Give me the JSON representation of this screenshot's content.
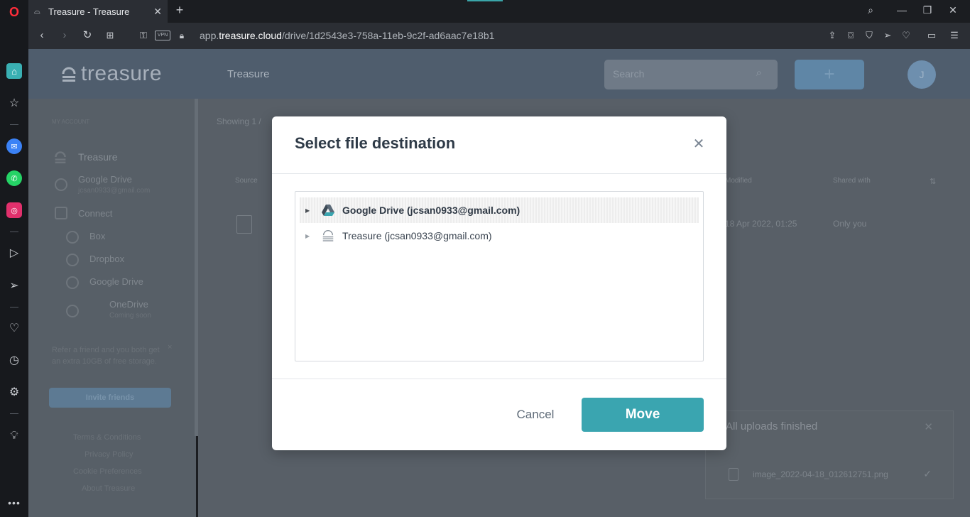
{
  "browser": {
    "tab_title": "Treasure - Treasure",
    "new_tab": "+",
    "url_prefix": "app.",
    "url_domain": "treasure.cloud",
    "url_path": "/drive/1d2543e3-758a-11eb-9c2f-ad6aac7e18b1",
    "vpn_label": "VPN"
  },
  "app": {
    "logo_text": "treasure",
    "header_title": "Treasure",
    "search_placeholder": "Search",
    "add_label": "+",
    "avatar_initial": "J"
  },
  "sidebar": {
    "section_label": "MY ACCOUNT",
    "treasure_label": "Treasure",
    "google_drive_label": "Google Drive",
    "google_drive_email": "jcsan0933@gmail.com",
    "connect_label": "Connect",
    "connect_items": [
      "Box",
      "Dropbox",
      "Google Drive",
      "OneDrive"
    ],
    "onedrive_sub": "Coming soon",
    "referral_text": "Refer a friend and you both get an extra 10GB of free storage.",
    "invite_label": "Invite friends",
    "footer_links": [
      "Terms & Conditions",
      "Privacy Policy",
      "Cookie Preferences",
      "About Treasure"
    ]
  },
  "main": {
    "showing_label": "Showing 1 /",
    "col_source": "Source",
    "col_modified": "Modified",
    "col_shared": "Shared with",
    "row_modified": "18 Apr 2022, 01:25",
    "row_shared": "Only you"
  },
  "uploads": {
    "title": "All uploads finished",
    "file_name": "image_2022-04-18_012612751.png"
  },
  "modal": {
    "title": "Select file destination",
    "tree": [
      {
        "label": "Google Drive (jcsan0933@gmail.com)",
        "icon": "google-drive-icon",
        "selected": true
      },
      {
        "label": "Treasure (jcsan0933@gmail.com)",
        "icon": "treasure-icon",
        "selected": false
      }
    ],
    "cancel_label": "Cancel",
    "move_label": "Move"
  },
  "colors": {
    "accent": "#3aa5b0",
    "header": "#4f5d6d",
    "overlay_dim": "#585f67"
  }
}
